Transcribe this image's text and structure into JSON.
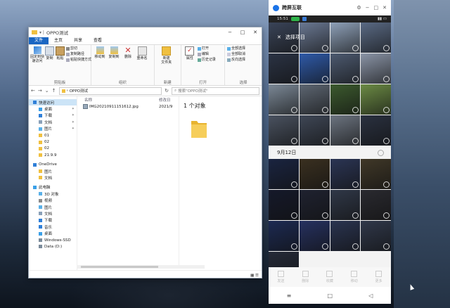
{
  "explorer": {
    "title": "OPPO测试",
    "menu": [
      "文件",
      "主页",
      "共享",
      "查看"
    ],
    "ribbon": {
      "clipboard": {
        "label": "剪贴板",
        "pin": "固定到快\n速访问",
        "copy": "复制",
        "paste": "粘贴",
        "cut": "剪切",
        "copy_path": "复制路径",
        "paste_shortcut": "粘贴快捷方式"
      },
      "organize": {
        "label": "组织",
        "move_to": "移动到",
        "copy_to": "复制到",
        "delete": "删除",
        "rename": "重命名"
      },
      "new": {
        "label": "新建",
        "new_folder": "新建\n文件夹"
      },
      "open": {
        "label": "打开",
        "properties": "属性",
        "open": "打开",
        "edit": "编辑",
        "history": "历史记录"
      },
      "select": {
        "label": "选择",
        "select_all": "全部选择",
        "select_none": "全部取消",
        "invert": "反向选择"
      }
    },
    "address": {
      "path": "OPPO测试",
      "search_placeholder": "搜索\"OPPO测试\""
    },
    "nav": [
      {
        "label": "快速访问",
        "sub": false,
        "icon": "star-icon",
        "color": "#2f7fd8",
        "pin": ""
      },
      {
        "label": "桌面",
        "sub": true,
        "icon": "desktop-icon",
        "color": "#3aa0e8",
        "pin": "✦"
      },
      {
        "label": "下载",
        "sub": true,
        "icon": "download-icon",
        "color": "#2f7fd8",
        "pin": "✦"
      },
      {
        "label": "文档",
        "sub": true,
        "icon": "document-icon",
        "color": "#8aa0b8",
        "pin": "✦"
      },
      {
        "label": "图片",
        "sub": true,
        "icon": "picture-icon",
        "color": "#5ab0e8",
        "pin": "✦"
      },
      {
        "label": "01",
        "sub": true,
        "icon": "folder-icon",
        "color": "#f0c040",
        "pin": ""
      },
      {
        "label": "02",
        "sub": true,
        "icon": "folder-icon",
        "color": "#f0c040",
        "pin": ""
      },
      {
        "label": "02",
        "sub": true,
        "icon": "folder-icon",
        "color": "#f0c040",
        "pin": ""
      },
      {
        "label": "21.9.9",
        "sub": true,
        "icon": "folder-icon",
        "color": "#f0c040",
        "pin": ""
      },
      {
        "label": "",
        "gap": true
      },
      {
        "label": "OneDrive",
        "sub": false,
        "icon": "cloud-icon",
        "color": "#2f7fd8",
        "pin": ""
      },
      {
        "label": "图片",
        "sub": true,
        "icon": "folder-icon",
        "color": "#f0c040",
        "pin": ""
      },
      {
        "label": "文档",
        "sub": true,
        "icon": "folder-icon",
        "color": "#f0c040",
        "pin": ""
      },
      {
        "label": "",
        "gap": true
      },
      {
        "label": "此电脑",
        "sub": false,
        "icon": "computer-icon",
        "color": "#3aa0e8",
        "pin": ""
      },
      {
        "label": "3D 对象",
        "sub": true,
        "icon": "cube-icon",
        "color": "#5ab0e8",
        "pin": ""
      },
      {
        "label": "视频",
        "sub": true,
        "icon": "video-icon",
        "color": "#8a8a8a",
        "pin": ""
      },
      {
        "label": "图片",
        "sub": true,
        "icon": "picture-icon",
        "color": "#5ab0e8",
        "pin": ""
      },
      {
        "label": "文档",
        "sub": true,
        "icon": "document-icon",
        "color": "#8aa0b8",
        "pin": ""
      },
      {
        "label": "下载",
        "sub": true,
        "icon": "download-icon",
        "color": "#2f7fd8",
        "pin": ""
      },
      {
        "label": "音乐",
        "sub": true,
        "icon": "music-icon",
        "color": "#2f7fd8",
        "pin": ""
      },
      {
        "label": "桌面",
        "sub": true,
        "icon": "desktop-icon",
        "color": "#3aa0e8",
        "pin": ""
      },
      {
        "label": "Windows-SSD",
        "sub": true,
        "icon": "drive-icon",
        "color": "#7a8a9a",
        "pin": ""
      },
      {
        "label": "Data (D:)",
        "sub": true,
        "icon": "drive-icon",
        "color": "#7a8a9a",
        "pin": ""
      }
    ],
    "columns": {
      "name": "名称",
      "date": "修改日"
    },
    "files": [
      {
        "name": "IMG20210911151612.jpg",
        "date": "2021/9"
      }
    ],
    "preview": {
      "count": "1 个对象"
    }
  },
  "phone": {
    "app_name": "跨屏互联",
    "status_time": "15:51",
    "header": "选择项目",
    "date_label": "9月12日",
    "top_tiles": [
      "#3a4458",
      "#6a7892",
      "#8ea0b8",
      "#5a6a84",
      "#2b3344",
      "#2f5aa8",
      "#4d5a70",
      "#8a94a6",
      "#7b8896",
      "#5d6672",
      "#3c5a2e",
      "#6b8a44",
      "#4a5260",
      "#3f4756",
      "#6c7480",
      "#2a3140"
    ],
    "sept_tiles": [
      "#1a2440",
      "#3a3020",
      "#2b3554",
      "#403828",
      "#15192a",
      "#1f2230",
      "#303848",
      "#2a2a30",
      "#1c2a52",
      "#263160",
      "#2a3450",
      "#30384a",
      "#252a38"
    ],
    "bottom_actions": [
      "发送",
      "删除",
      "收藏",
      "移动",
      "更多"
    ],
    "controls": {
      "settings": "⚙",
      "minimize": "−",
      "maximize": "□",
      "close": "✕"
    },
    "nav": {
      "menu": "≡",
      "home": "□",
      "back": "◁"
    }
  },
  "colors": {
    "accent": "#1a66c2",
    "phone_brand": "#1b73e8",
    "folder": "#f0c040"
  }
}
